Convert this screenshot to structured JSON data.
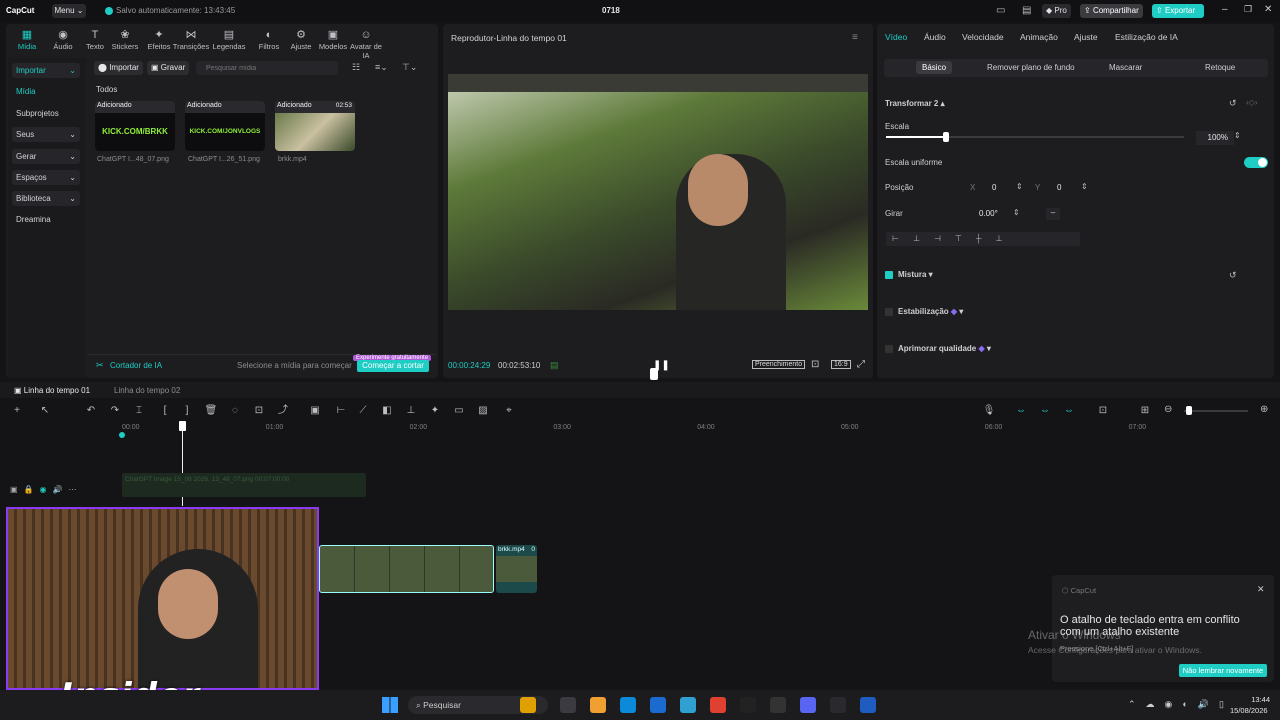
{
  "titlebar": {
    "logo": "CapCut",
    "menu": "Menu",
    "autosave": "Salvo automaticamente: 13:43:45",
    "project": "0718",
    "pro": "Pro",
    "share": "Compartilhar",
    "export": "Exportar",
    "accent": "#1ecdc3"
  },
  "toolbar": [
    "Mídia",
    "Áudio",
    "Texto",
    "Stickers",
    "Efeitos",
    "Transições",
    "Legendas",
    "Filtros",
    "Ajuste",
    "Modelos",
    "Avatar de IA"
  ],
  "sidebar": [
    "Importar",
    "Mídia",
    "Subprojetos",
    "Seus",
    "Gerar",
    "Espaços",
    "Biblioteca",
    "Dreamina"
  ],
  "media": {
    "import": "Importar",
    "record": "Gravar",
    "search_placeholder": "Pesquisar mídia",
    "filter": "Todos",
    "items": [
      {
        "tag": "Adicionado",
        "caption": "ChatGPT I...48_07.png",
        "art": "KICK.COM/BRKK"
      },
      {
        "tag": "Adicionado",
        "caption": "ChatGPT I...26_51.png",
        "art": "KICK.COM/JONVLOGS"
      },
      {
        "tag": "Adicionado",
        "caption": "brkk.mp4",
        "duration": "02:53"
      }
    ],
    "footer_label": "Cortador de IA",
    "footer_hint": "Selecione a mídia para começar",
    "trial_badge": "Experimente gratuitamente",
    "start_cut": "Começar a cortar"
  },
  "player": {
    "title": "Reprodutor-Linha do tempo 01",
    "current": "00:00:24:29",
    "total": "00:02:53:10",
    "fill": "Preenchimento",
    "ratio": "16:9"
  },
  "props": {
    "tabs": [
      "Vídeo",
      "Áudio",
      "Velocidade",
      "Animação",
      "Ajuste",
      "Estilização de IA"
    ],
    "subtabs": [
      "Básico",
      "Remover plano de fundo",
      "Mascarar",
      "Retoque"
    ],
    "transform": "Transformar 2",
    "scale_label": "Escala",
    "scale_value": "100%",
    "scale_fraction": 0.2,
    "uniform": "Escala uniforme",
    "position": "Posição",
    "x_label": "X",
    "x_value": "0",
    "y_label": "Y",
    "y_value": "0",
    "rotate": "Girar",
    "rotate_value": "0.00°",
    "rotate_button": "–",
    "blend": "Mistura",
    "stabilize": "Estabilização",
    "enhance": "Aprimorar qualidade"
  },
  "timeline": {
    "tab1": "Linha do tempo 01",
    "tab2": "Linha do tempo 02",
    "ruler": [
      "00:00",
      "01:00",
      "02:00",
      "03:00",
      "04:00",
      "05:00",
      "06:00",
      "07:00"
    ],
    "clip1": "ChatGPT Image 15_08 2026, 13_48_07.png 00:07:00:00",
    "clip2_name": "brkk.mp4",
    "clip2_badge": "0"
  },
  "toast": {
    "app": "CapCut",
    "message": "O atalho de teclado entra em conflito com um atalho existente",
    "sub": "Pressione [Ctrl+Alt+F]",
    "button": "Não lembrar novamente"
  },
  "watermark": {
    "line1": "Ativar o Windows",
    "line2": "Acesse Configurações para ativar o Windows."
  },
  "webcam": {
    "overlay": "Insider"
  },
  "taskbar": {
    "search": "Pesquisar",
    "time": "13:44",
    "date": "15/08/2026"
  }
}
